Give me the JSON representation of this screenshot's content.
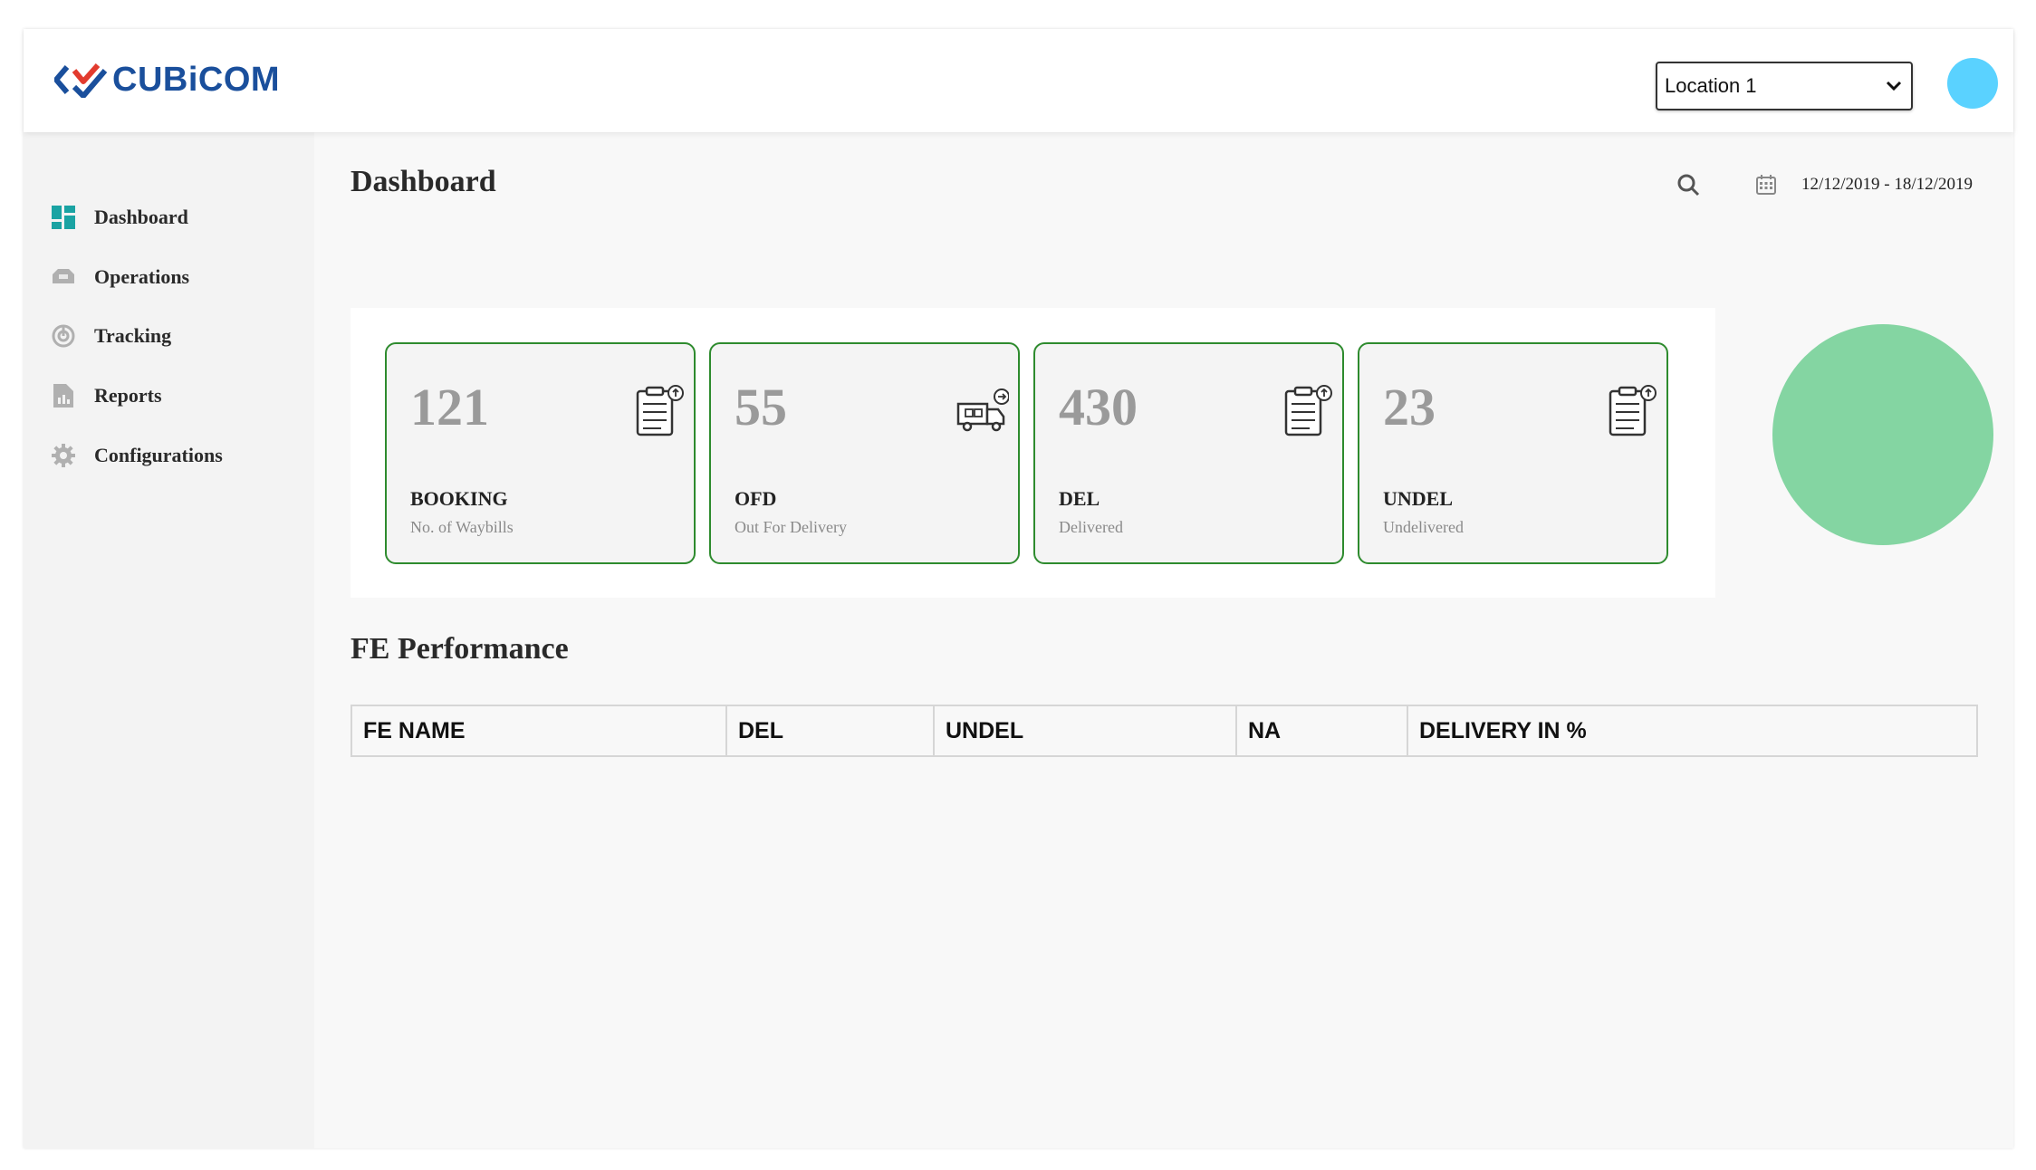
{
  "header": {
    "logo_text": "CUBiCOM",
    "location": {
      "selected": "Location 1"
    }
  },
  "sidebar": {
    "items": [
      {
        "label": "Dashboard",
        "icon": "dashboard-icon",
        "active": true
      },
      {
        "label": "Operations",
        "icon": "operations-icon"
      },
      {
        "label": "Tracking",
        "icon": "tracking-icon"
      },
      {
        "label": "Reports",
        "icon": "reports-icon"
      },
      {
        "label": "Configurations",
        "icon": "gear-icon"
      }
    ]
  },
  "main": {
    "title": "Dashboard",
    "date_range": "12/12/2019 - 18/12/2019",
    "cards": [
      {
        "value": "121",
        "code": "BOOKING",
        "desc": "No. of Waybills",
        "icon": "clipboard-icon"
      },
      {
        "value": "55",
        "code": "OFD",
        "desc": "Out For Delivery",
        "icon": "truck-icon"
      },
      {
        "value": "430",
        "code": "DEL",
        "desc": "Delivered",
        "icon": "clipboard-icon"
      },
      {
        "value": "23",
        "code": "UNDEL",
        "desc": "Undelivered",
        "icon": "clipboard-icon"
      }
    ],
    "fe_performance": {
      "title": "FE Performance",
      "columns": [
        "FE NAME",
        "DEL",
        "UNDEL",
        "NA",
        "DELIVERY IN %"
      ]
    }
  },
  "colors": {
    "brand": "#1a4f9c",
    "card_border": "#2e8b2e",
    "pie": "#84d5a2",
    "avatar": "#5ad2ff"
  }
}
